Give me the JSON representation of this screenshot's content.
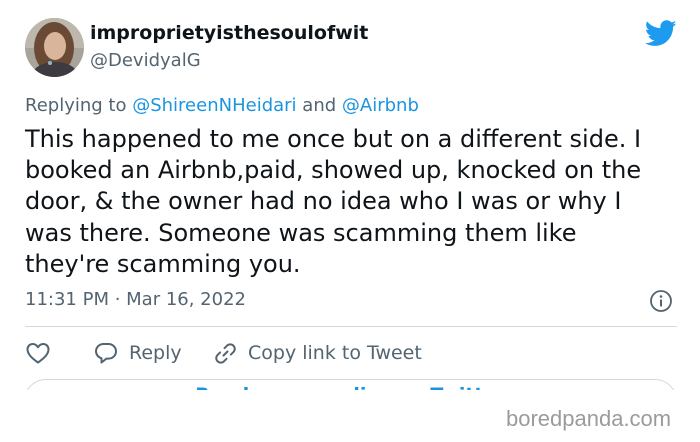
{
  "tweet": {
    "display_name": "improprietyisthesoulofwit",
    "handle": "@DevidyalG",
    "replying": {
      "prefix": "Replying to",
      "mention1": "@ShireenNHeidari",
      "joiner": "and",
      "mention2": "@Airbnb"
    },
    "text": "This happened to me once but on a different side. I\nbooked an Airbnb,paid, showed up, knocked on the\ndoor, & the owner had no idea who I was or why I\nwas there. Someone was scamming them like\nthey're scamming you.",
    "timestamp": "11:31 PM · Mar 16, 2022"
  },
  "actions": {
    "like_icon": "heart-icon",
    "reply_label": "Reply",
    "reply_icon": "speech-bubble-icon",
    "copy_label": "Copy link to Tweet",
    "copy_icon": "link-icon"
  },
  "read_replies_partial": "Read more replies on Twitter",
  "watermark": "boredpanda.com",
  "colors": {
    "twitter_blue": "#1d9bf0",
    "mention_blue": "#1b95e0",
    "text": "#0f1419",
    "secondary_text": "#536471",
    "divider": "#cfd9de",
    "watermark": "#9b9b9b"
  }
}
